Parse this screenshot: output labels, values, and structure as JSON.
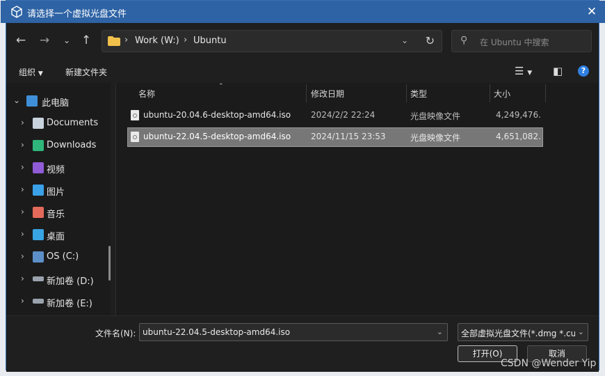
{
  "title": "请选择一个虚拟光盘文件",
  "address": {
    "crumbs": [
      "Work (W:)",
      "Ubuntu"
    ]
  },
  "search": {
    "placeholder": "在 Ubuntu 中搜索"
  },
  "toolbar": {
    "organize": "组织",
    "new_folder": "新建文件夹"
  },
  "nav": {
    "root": "此电脑",
    "items": [
      {
        "label": "Documents",
        "icon": "document-icon"
      },
      {
        "label": "Downloads",
        "icon": "download-icon"
      },
      {
        "label": "视频",
        "icon": "video-icon"
      },
      {
        "label": "图片",
        "icon": "picture-icon"
      },
      {
        "label": "音乐",
        "icon": "music-icon"
      },
      {
        "label": "桌面",
        "icon": "desktop-icon"
      },
      {
        "label": "OS (C:)",
        "icon": "os-drive-icon"
      },
      {
        "label": "新加卷 (D:)",
        "icon": "drive-icon"
      },
      {
        "label": "新加卷 (E:)",
        "icon": "drive-icon"
      }
    ]
  },
  "columns": {
    "name": "名称",
    "date": "修改日期",
    "type": "类型",
    "size": "大小"
  },
  "files": [
    {
      "name": "ubuntu-20.04.6-desktop-amd64.iso",
      "date": "2024/2/2 22:24",
      "type": "光盘映像文件",
      "size": "4,249,476..."
    },
    {
      "name": "ubuntu-22.04.5-desktop-amd64.iso",
      "date": "2024/11/15 23:53",
      "type": "光盘映像文件",
      "size": "4,651,082..."
    }
  ],
  "bottom": {
    "filename_label": "文件名(N):",
    "filename_value": "ubuntu-22.04.5-desktop-amd64.iso",
    "filetype_value": "全部虚拟光盘文件(*.dmg *.cue",
    "open": "打开(O)",
    "cancel": "取消"
  },
  "watermark": "CSDN @Wender Yip",
  "colors": {
    "titlebar": "#2e63a5",
    "selected_row": "#777777",
    "accent": "#2f7fe0"
  }
}
